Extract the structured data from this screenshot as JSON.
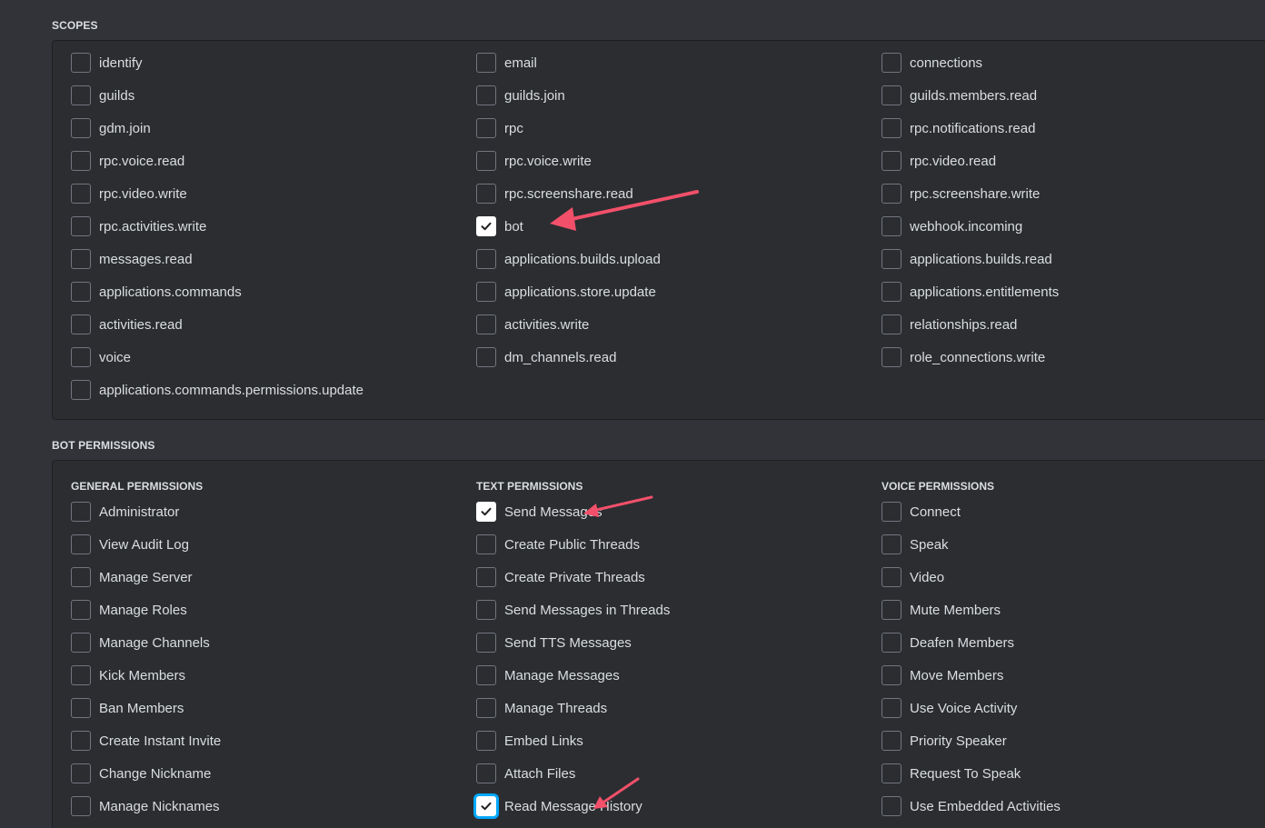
{
  "scopes": {
    "title": "SCOPES",
    "columns": [
      [
        {
          "label": "identify",
          "checked": false
        },
        {
          "label": "guilds",
          "checked": false
        },
        {
          "label": "gdm.join",
          "checked": false
        },
        {
          "label": "rpc.voice.read",
          "checked": false
        },
        {
          "label": "rpc.video.write",
          "checked": false
        },
        {
          "label": "rpc.activities.write",
          "checked": false
        },
        {
          "label": "messages.read",
          "checked": false
        },
        {
          "label": "applications.commands",
          "checked": false
        },
        {
          "label": "activities.read",
          "checked": false
        },
        {
          "label": "voice",
          "checked": false
        },
        {
          "label": "applications.commands.permissions.update",
          "checked": false
        }
      ],
      [
        {
          "label": "email",
          "checked": false
        },
        {
          "label": "guilds.join",
          "checked": false
        },
        {
          "label": "rpc",
          "checked": false
        },
        {
          "label": "rpc.voice.write",
          "checked": false
        },
        {
          "label": "rpc.screenshare.read",
          "checked": false
        },
        {
          "label": "bot",
          "checked": true
        },
        {
          "label": "applications.builds.upload",
          "checked": false
        },
        {
          "label": "applications.store.update",
          "checked": false
        },
        {
          "label": "activities.write",
          "checked": false
        },
        {
          "label": "dm_channels.read",
          "checked": false
        }
      ],
      [
        {
          "label": "connections",
          "checked": false
        },
        {
          "label": "guilds.members.read",
          "checked": false
        },
        {
          "label": "rpc.notifications.read",
          "checked": false
        },
        {
          "label": "rpc.video.read",
          "checked": false
        },
        {
          "label": "rpc.screenshare.write",
          "checked": false
        },
        {
          "label": "webhook.incoming",
          "checked": false
        },
        {
          "label": "applications.builds.read",
          "checked": false
        },
        {
          "label": "applications.entitlements",
          "checked": false
        },
        {
          "label": "relationships.read",
          "checked": false
        },
        {
          "label": "role_connections.write",
          "checked": false
        }
      ]
    ]
  },
  "bot_permissions": {
    "title": "BOT PERMISSIONS",
    "columns": [
      {
        "header": "GENERAL PERMISSIONS",
        "items": [
          {
            "label": "Administrator",
            "checked": false
          },
          {
            "label": "View Audit Log",
            "checked": false
          },
          {
            "label": "Manage Server",
            "checked": false
          },
          {
            "label": "Manage Roles",
            "checked": false
          },
          {
            "label": "Manage Channels",
            "checked": false
          },
          {
            "label": "Kick Members",
            "checked": false
          },
          {
            "label": "Ban Members",
            "checked": false
          },
          {
            "label": "Create Instant Invite",
            "checked": false
          },
          {
            "label": "Change Nickname",
            "checked": false
          },
          {
            "label": "Manage Nicknames",
            "checked": false
          }
        ]
      },
      {
        "header": "TEXT PERMISSIONS",
        "items": [
          {
            "label": "Send Messages",
            "checked": true
          },
          {
            "label": "Create Public Threads",
            "checked": false
          },
          {
            "label": "Create Private Threads",
            "checked": false
          },
          {
            "label": "Send Messages in Threads",
            "checked": false
          },
          {
            "label": "Send TTS Messages",
            "checked": false
          },
          {
            "label": "Manage Messages",
            "checked": false
          },
          {
            "label": "Manage Threads",
            "checked": false
          },
          {
            "label": "Embed Links",
            "checked": false
          },
          {
            "label": "Attach Files",
            "checked": false
          },
          {
            "label": "Read Message History",
            "checked": true,
            "focused": true
          }
        ]
      },
      {
        "header": "VOICE PERMISSIONS",
        "items": [
          {
            "label": "Connect",
            "checked": false
          },
          {
            "label": "Speak",
            "checked": false
          },
          {
            "label": "Video",
            "checked": false
          },
          {
            "label": "Mute Members",
            "checked": false
          },
          {
            "label": "Deafen Members",
            "checked": false
          },
          {
            "label": "Move Members",
            "checked": false
          },
          {
            "label": "Use Voice Activity",
            "checked": false
          },
          {
            "label": "Priority Speaker",
            "checked": false
          },
          {
            "label": "Request To Speak",
            "checked": false
          },
          {
            "label": "Use Embedded Activities",
            "checked": false
          }
        ]
      }
    ]
  },
  "colors": {
    "background": "#313338",
    "panel": "#2b2d31",
    "annotation_arrow": "#f2506a",
    "focus_ring": "#00a8fc"
  },
  "icons": {
    "checkbox_check": "checkmark-icon",
    "annotation": "arrow-icon"
  }
}
